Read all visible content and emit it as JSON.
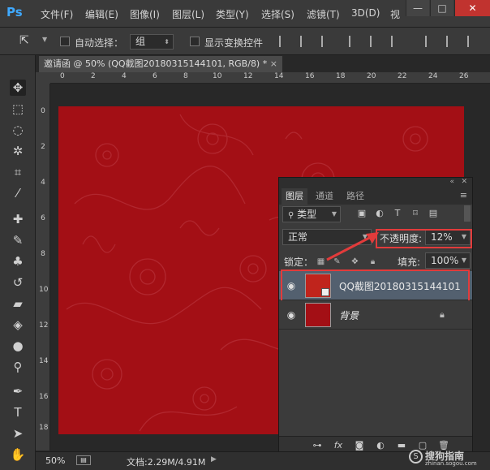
{
  "app": {
    "logo": "Ps"
  },
  "menu": [
    "文件(F)",
    "编辑(E)",
    "图像(I)",
    "图层(L)",
    "类型(Y)",
    "选择(S)",
    "滤镜(T)",
    "3D(D)",
    "视"
  ],
  "window_controls": {
    "minimize": "—",
    "maximize": "□",
    "close": "✕"
  },
  "options_bar": {
    "auto_select_label": "自动选择：",
    "auto_select_value": "组",
    "show_transform_label": "显示变换控件"
  },
  "document_tab": {
    "title": "邀请函 @ 50% (QQ截图20180315144101, RGB/8) *",
    "close": "×"
  },
  "ruler": {
    "h_ticks": [
      "0",
      "2",
      "4",
      "6",
      "8",
      "10",
      "12",
      "14",
      "16",
      "18",
      "20",
      "22",
      "24",
      "26"
    ],
    "v_ticks": [
      "0",
      "2",
      "4",
      "6",
      "8",
      "10",
      "12",
      "14",
      "16",
      "18"
    ]
  },
  "status_bar": {
    "zoom": "50%",
    "doc_info": "文档:2.29M/4.91M"
  },
  "layers_panel": {
    "tabs": [
      "图层",
      "通道",
      "路径"
    ],
    "filter_kind": "类型",
    "blend_mode": "正常",
    "opacity_label": "不透明度:",
    "opacity_value": "12%",
    "lock_label": "锁定：",
    "fill_label": "填充:",
    "fill_value": "100%",
    "layers": [
      {
        "name": "QQ截图20180315144101",
        "selected": true
      },
      {
        "name": "背景",
        "locked": true
      }
    ]
  },
  "watermark": {
    "circle": "S",
    "text": "搜狗指南",
    "url": "zhinan.sogou.com"
  },
  "colors": {
    "accent_blue": "#3fa9ff",
    "document_red": "#a30f15",
    "highlight_red": "#e23b3b"
  }
}
